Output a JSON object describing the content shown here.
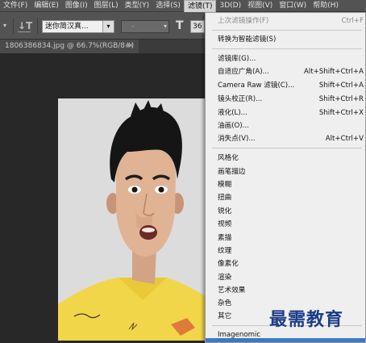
{
  "menubar": {
    "items": [
      "文件(F)",
      "编辑(E)",
      "图像(I)",
      "图层(L)",
      "类型(Y)",
      "选择(S)",
      "滤镜(T)",
      "3D(D)",
      "视图(V)",
      "窗口(W)",
      "帮助(H)"
    ],
    "active": "滤镜(T)"
  },
  "options_bar": {
    "font_family": "迷你简汉真...",
    "font_style": "-",
    "font_size": "36"
  },
  "document_tab": {
    "title": "1806386834.jpg @ 66.7%(RGB/8#)",
    "close": "×"
  },
  "filter_menu": {
    "items": [
      {
        "label": "上次滤镜操作(F)",
        "shortcut": "Ctrl+F",
        "disabled": true
      },
      {
        "label": "转换为智能滤镜(S)",
        "shortcut": ""
      },
      {
        "label": "滤镜库(G)...",
        "shortcut": ""
      },
      {
        "label": "自适应广角(A)...",
        "shortcut": "Alt+Shift+Ctrl+A"
      },
      {
        "label": "Camera Raw 滤镜(C)...",
        "shortcut": "Shift+Ctrl+A"
      },
      {
        "label": "镜头校正(R)...",
        "shortcut": "Shift+Ctrl+R"
      },
      {
        "label": "液化(L)...",
        "shortcut": "Shift+Ctrl+X"
      },
      {
        "label": "油画(O)...",
        "shortcut": ""
      },
      {
        "label": "消失点(V)...",
        "shortcut": "Alt+Ctrl+V"
      },
      {
        "label": "风格化",
        "shortcut": ""
      },
      {
        "label": "画笔描边",
        "shortcut": ""
      },
      {
        "label": "模糊",
        "shortcut": ""
      },
      {
        "label": "扭曲",
        "shortcut": ""
      },
      {
        "label": "锐化",
        "shortcut": ""
      },
      {
        "label": "视频",
        "shortcut": ""
      },
      {
        "label": "素描",
        "shortcut": ""
      },
      {
        "label": "纹理",
        "shortcut": ""
      },
      {
        "label": "像素化",
        "shortcut": ""
      },
      {
        "label": "渲染",
        "shortcut": ""
      },
      {
        "label": "艺术效果",
        "shortcut": ""
      },
      {
        "label": "杂色",
        "shortcut": ""
      },
      {
        "label": "其它",
        "shortcut": ""
      },
      {
        "label": "Imagenomic",
        "shortcut": ""
      }
    ]
  },
  "watermark": "最需教育",
  "colors": {
    "menubar_bg": "#535353",
    "menu_bg": "#efefef",
    "canvas_bg": "#282828",
    "shirt": "#f2d64a",
    "watermark": "#1b3c8a"
  }
}
